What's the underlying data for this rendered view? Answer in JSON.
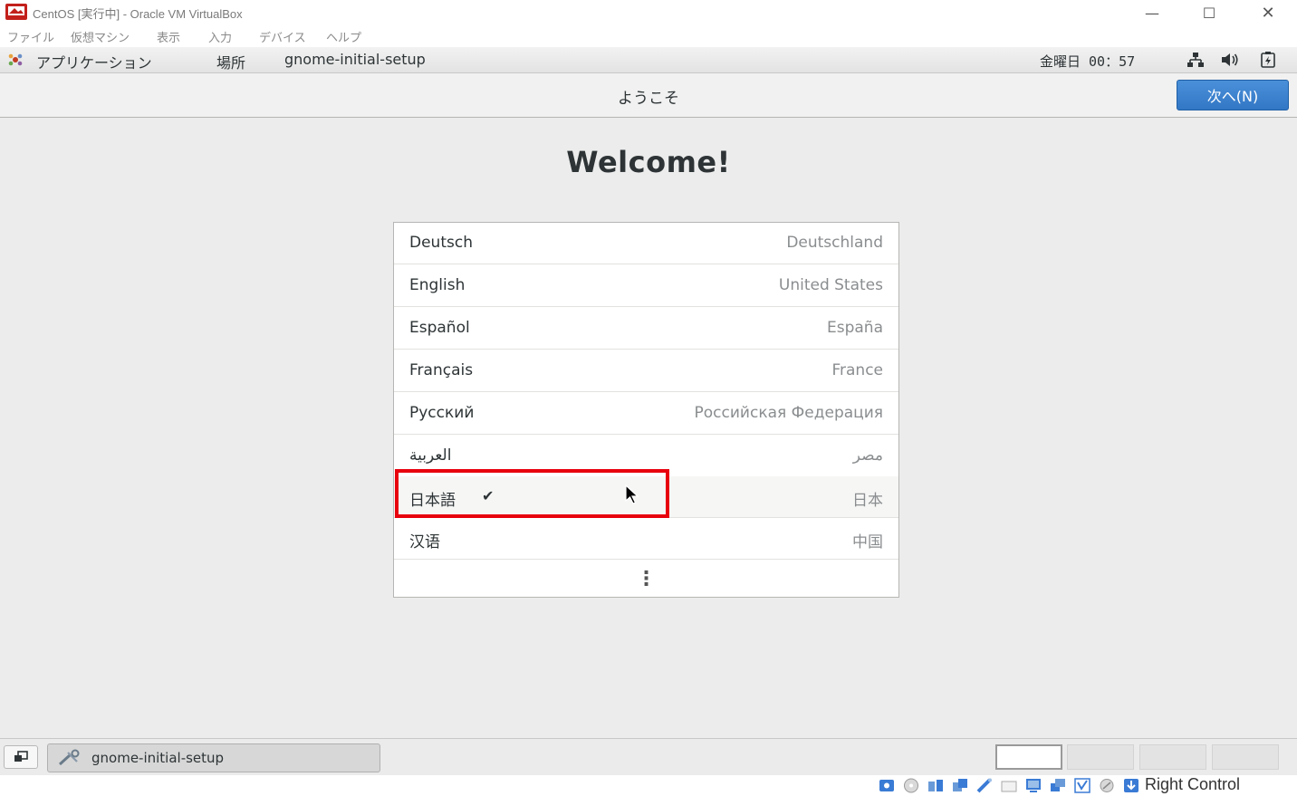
{
  "window": {
    "title": "CentOS [実行中] - Oracle VM VirtualBox",
    "minimize_glyph": "—",
    "maximize_glyph": "☐",
    "close_glyph": "✕"
  },
  "vm_menu": [
    "ファイル",
    "仮想マシン",
    "表示",
    "入力",
    "デバイス",
    "ヘルプ"
  ],
  "gnome_panel": {
    "applications": "アプリケーション",
    "places": "場所",
    "app_name": "gnome-initial-setup",
    "clock": "金曜日 00：57",
    "tray_icons": [
      "network-icon",
      "volume-icon",
      "power-icon"
    ]
  },
  "header": {
    "title": "ようこそ",
    "next_button": "次へ(N)"
  },
  "welcome_title": "Welcome!",
  "languages": [
    {
      "name": "Deutsch",
      "region": "Deutschland",
      "selected": false
    },
    {
      "name": "English",
      "region": "United States",
      "selected": false
    },
    {
      "name": "Español",
      "region": "España",
      "selected": false
    },
    {
      "name": "Français",
      "region": "France",
      "selected": false
    },
    {
      "name": "Русский",
      "region": "Российская Федерация",
      "selected": false
    },
    {
      "name": "العربية",
      "region": "مصر",
      "selected": false
    },
    {
      "name": "日本語",
      "region": "日本",
      "selected": true
    },
    {
      "name": "汉语",
      "region": "中国",
      "selected": false
    }
  ],
  "check_glyph": "✔",
  "more_glyph": "⋮",
  "bottom_panel": {
    "task_label": "gnome-initial-setup",
    "workspaces": 4,
    "active_workspace": 1
  },
  "status_bar": {
    "host_key": "Right Control"
  },
  "colors": {
    "accent": "#3277c5",
    "highlight": "#e8000d"
  }
}
